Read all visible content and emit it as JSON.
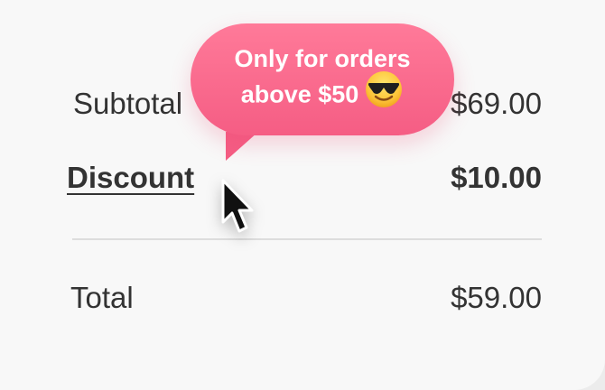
{
  "summary": {
    "subtotal": {
      "label": "Subtotal",
      "value": "$69.00"
    },
    "discount": {
      "label": "Discount",
      "value": "$10.00"
    },
    "total": {
      "label": "Total",
      "value": "$59.00"
    }
  },
  "tooltip": {
    "line1": "Only for orders",
    "line2": "above $50",
    "emoji": "smiling-face-with-sunglasses-icon"
  },
  "colors": {
    "tooltip": "#f55d84",
    "text": "#333333",
    "background": "#f8f8f8"
  }
}
